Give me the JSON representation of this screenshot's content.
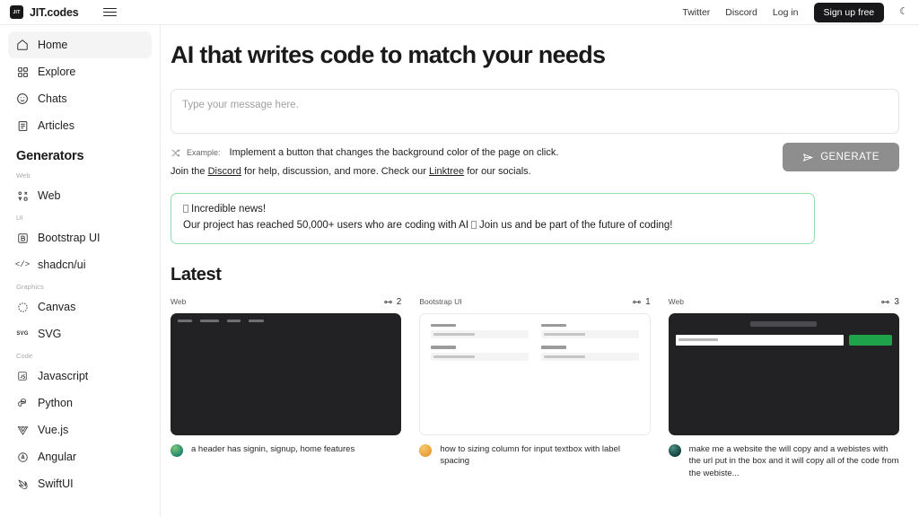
{
  "topbar": {
    "logo_badge": "JIT",
    "logo_text": "JIT.codes",
    "menu_icon": "hamburger-icon",
    "links": [
      {
        "label": "Twitter",
        "name": "twitter-link"
      },
      {
        "label": "Discord",
        "name": "discord-link"
      },
      {
        "label": "Log in",
        "name": "login-link"
      }
    ],
    "signup_label": "Sign up free",
    "theme_icon": "moon-icon"
  },
  "sidebar": {
    "nav": [
      {
        "label": "Home",
        "icon": "home-icon",
        "active": true
      },
      {
        "label": "Explore",
        "icon": "grid-icon",
        "active": false
      },
      {
        "label": "Chats",
        "icon": "smiley-icon",
        "active": false
      },
      {
        "label": "Articles",
        "icon": "article-icon",
        "active": false
      }
    ],
    "generators_title": "Generators",
    "groups": [
      {
        "category": "Web",
        "items": [
          {
            "label": "Web",
            "icon": "nodes-icon"
          }
        ]
      },
      {
        "category": "UI",
        "items": [
          {
            "label": "Bootstrap UI",
            "icon": "bootstrap-icon"
          },
          {
            "label": "shadcn/ui",
            "icon": "code-brackets-icon"
          }
        ]
      },
      {
        "category": "Graphics",
        "items": [
          {
            "label": "Canvas",
            "icon": "canvas-icon"
          },
          {
            "label": "SVG",
            "icon": "svg-icon"
          }
        ]
      },
      {
        "category": "Code",
        "items": [
          {
            "label": "Javascript",
            "icon": "javascript-icon"
          },
          {
            "label": "Python",
            "icon": "python-icon"
          },
          {
            "label": "Vue.js",
            "icon": "vue-icon"
          },
          {
            "label": "Angular",
            "icon": "angular-icon"
          },
          {
            "label": "SwiftUI",
            "icon": "swiftui-icon"
          }
        ]
      }
    ]
  },
  "main": {
    "heading": "AI that writes code to match your needs",
    "prompt_placeholder": "Type your message here.",
    "example_label": "Example:",
    "example_text": "Implement a button that changes the background color of the page on click.",
    "shuffle_icon": "shuffle-icon",
    "generate_label": "GENERATE",
    "generate_icon": "send-icon",
    "join": {
      "prefix": "Join the ",
      "link1": "Discord",
      "middle": " for help, discussion, and more. Check our ",
      "link2": "Linktree",
      "suffix": " for our socials."
    },
    "banner": {
      "line1": "Incredible news!",
      "line2_a": "Our project has reached 50,000+ users who are coding with AI",
      "line2_b": "Join us and be part of the future of coding!",
      "border_color": "#8fe0ab"
    },
    "latest_title": "Latest",
    "cards": [
      {
        "tag": "Web",
        "count": "2",
        "count_icon": "fork-icon",
        "thumb": "dark-navbar",
        "avatar": "av-green",
        "caption": "a header has signin, signup, home features"
      },
      {
        "tag": "Bootstrap UI",
        "count": "1",
        "count_icon": "fork-icon",
        "thumb": "light-form",
        "avatar": "av-orange",
        "caption": "how to sizing column for input textbox with label spacing"
      },
      {
        "tag": "Web",
        "count": "3",
        "count_icon": "fork-icon",
        "thumb": "dark-search",
        "avatar": "av-teal",
        "caption": "make me a website the will copy and a webistes with the url put in the box and it will copy all of the code from the webiste..."
      }
    ]
  }
}
